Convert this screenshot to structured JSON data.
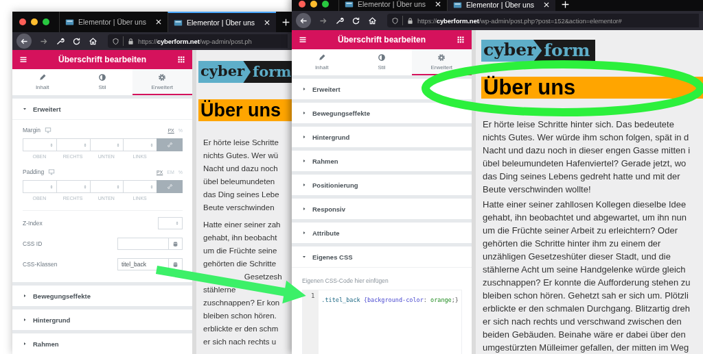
{
  "windows": [
    {
      "tabs": [
        {
          "title": "Elementor | Über uns",
          "selected": false
        },
        {
          "title": "Elementor | Über uns",
          "selected": true
        }
      ],
      "url": "https://**cyberform.net**/wp-admin/post.ph",
      "panel": {
        "title": "Überschrift bearbeiten",
        "tabs": [
          {
            "label": "Inhalt",
            "selected": false
          },
          {
            "label": "Stil",
            "selected": false
          },
          {
            "label": "Erweitert",
            "selected": true
          }
        ],
        "sections": [
          {
            "title": "Erweitert",
            "expanded": true,
            "controls": [
              {
                "kind": "dimensions",
                "label": "Margin",
                "units": [
                  {
                    "label": "PX",
                    "selected": true
                  },
                  {
                    "label": "%",
                    "selected": false
                  }
                ],
                "sides": [
                  "OBEN",
                  "RECHTS",
                  "UNTEN",
                  "LINKS"
                ]
              },
              {
                "kind": "dimensions",
                "label": "Padding",
                "units": [
                  {
                    "label": "PX",
                    "selected": true
                  },
                  {
                    "label": "EM",
                    "selected": false
                  },
                  {
                    "label": "%",
                    "selected": false
                  }
                ],
                "sides": [
                  "OBEN",
                  "RECHTS",
                  "UNTEN",
                  "LINKS"
                ]
              },
              {
                "kind": "number",
                "label": "Z-Index"
              },
              {
                "kind": "text",
                "label": "CSS ID"
              },
              {
                "kind": "text",
                "label": "CSS-Klassen",
                "value": "titel_back"
              }
            ]
          },
          {
            "title": "Bewegungseffekte",
            "expanded": false
          },
          {
            "title": "Hintergrund",
            "expanded": false
          },
          {
            "title": "Rahmen",
            "expanded": false
          }
        ]
      },
      "preview": {
        "logo": [
          "cyber",
          "form"
        ],
        "heading": "Über uns",
        "paragraphs": [
          [
            "Er hörte leise Schritte",
            "nichts Gutes. Wer wü",
            "Nacht und dazu noch",
            "übel beleumundeten",
            "das Ding seines Lebe",
            "Beute verschwinden"
          ],
          [
            "Hatte einer seiner zah",
            "gehabt, ihn beobacht",
            "um die Früchte seine",
            "gehörten die Schritte",
            {
              "fragments": [
                "Gesetzesh"
              ],
              "covered_start": true
            },
            "stählerne",
            "zuschnappen? Er kon",
            "bleiben schon hören.",
            "erblickte er den schm",
            "er sich nach rechts u"
          ]
        ]
      }
    },
    {
      "tabs": [
        {
          "title": "Elementor | Über uns",
          "selected": false
        },
        {
          "title": "Elementor | Über uns",
          "selected": true
        }
      ],
      "url": "https://**cyberform.net**/wp-admin/post.php?post=152&action=elementor#",
      "panel": {
        "title": "Überschrift bearbeiten",
        "tabs": [
          {
            "label": "Inhalt",
            "selected": false
          },
          {
            "label": "Stil",
            "selected": false
          },
          {
            "label": "Erweitert",
            "selected": true
          }
        ],
        "sections": [
          {
            "title": "Erweitert",
            "expanded": false
          },
          {
            "title": "Bewegungseffekte",
            "expanded": false
          },
          {
            "title": "Hintergrund",
            "expanded": false
          },
          {
            "title": "Rahmen",
            "expanded": false
          },
          {
            "title": "Positionierung",
            "expanded": false
          },
          {
            "title": "Responsiv",
            "expanded": false
          },
          {
            "title": "Attribute",
            "expanded": false
          },
          {
            "title": "Eigenes CSS",
            "expanded": true,
            "controls": [
              {
                "kind": "css",
                "label": "Eigenen CSS-Code hier einfügen",
                "line_number": "1",
                "tokens": [
                  {
                    "text": ".titel_back ",
                    "kind": "selector"
                  },
                  {
                    "text": "{background-color",
                    "kind": "property"
                  },
                  {
                    "text": ": ",
                    "kind": "punct"
                  },
                  {
                    "text": "orange",
                    "kind": "value"
                  },
                  {
                    "text": ";}",
                    "kind": "punct"
                  }
                ]
              }
            ]
          }
        ]
      },
      "preview": {
        "logo": [
          "cyber",
          "form"
        ],
        "heading": "Über uns",
        "paragraphs": [
          [
            "Er hörte leise Schritte hinter sich. Das bedeutete",
            "nichts Gutes. Wer würde ihm schon folgen, spät in d",
            "Nacht und dazu noch in dieser engen Gasse mitten i",
            "übel beleumundeten Hafenviertel? Gerade jetzt, wo",
            "das Ding seines Lebens gedreht hatte und mit der",
            "Beute verschwinden wollte!"
          ],
          [
            "Hatte einer seiner zahllosen Kollegen dieselbe Idee",
            "gehabt, ihn beobachtet und abgewartet, um ihn nun",
            "um die Früchte seiner Arbeit zu erleichtern? Oder",
            "gehörten die Schritte hinter ihm zu einem der",
            "unzähligen Gesetzeshüter dieser Stadt, und die",
            "stählerne Acht um seine Handgelenke würde gleich",
            "zuschnappen? Er konnte die Aufforderung stehen zu",
            "bleiben schon hören. Gehetzt sah er sich um. Plötzli",
            "erblickte er den schmalen Durchgang. Blitzartig dreh",
            "er sich nach rechts und verschwand zwischen den",
            "beiden Gebäuden. Beinahe wäre er dabei über den",
            "umgestürzten Mülleimer gefallen, der mitten im Weg"
          ]
        ]
      }
    }
  ]
}
